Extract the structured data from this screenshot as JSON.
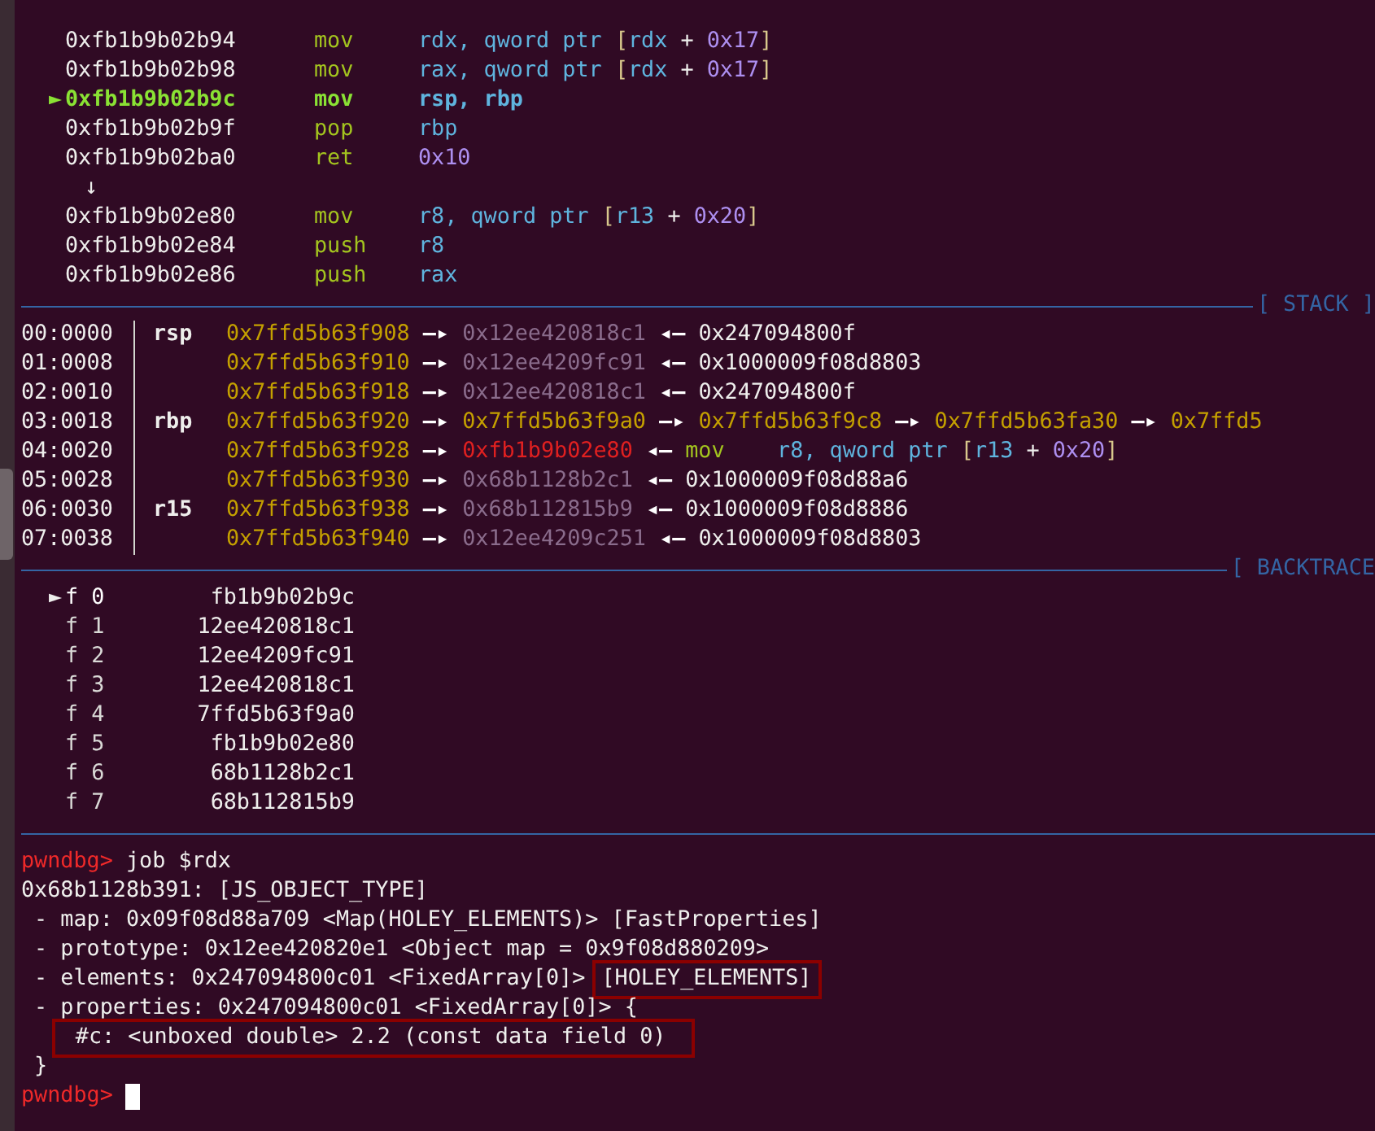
{
  "disassembly": [
    {
      "kind": "instr",
      "current": false,
      "address": "0xfb1b9b02b94",
      "mnemonic": "mov",
      "operands": [
        {
          "text": "rdx, qword ptr ",
          "kind": "reg"
        },
        {
          "text": "[",
          "kind": "brk"
        },
        {
          "text": "rdx ",
          "kind": "reg"
        },
        {
          "text": "+ ",
          "kind": "op"
        },
        {
          "text": "0x17",
          "kind": "num"
        },
        {
          "text": "]",
          "kind": "brk"
        }
      ]
    },
    {
      "kind": "instr",
      "current": false,
      "address": "0xfb1b9b02b98",
      "mnemonic": "mov",
      "operands": [
        {
          "text": "rax, qword ptr ",
          "kind": "reg"
        },
        {
          "text": "[",
          "kind": "brk"
        },
        {
          "text": "rdx ",
          "kind": "reg"
        },
        {
          "text": "+ ",
          "kind": "op"
        },
        {
          "text": "0x17",
          "kind": "num"
        },
        {
          "text": "]",
          "kind": "brk"
        }
      ]
    },
    {
      "kind": "instr",
      "current": true,
      "marker": "►",
      "address": "0xfb1b9b02b9c",
      "mnemonic": "mov",
      "operands": [
        {
          "text": "rsp, rbp",
          "kind": "reg"
        }
      ]
    },
    {
      "kind": "instr",
      "current": false,
      "address": "0xfb1b9b02b9f",
      "mnemonic": "pop",
      "operands": [
        {
          "text": "rbp",
          "kind": "reg"
        }
      ]
    },
    {
      "kind": "instr",
      "current": false,
      "address": "0xfb1b9b02ba0",
      "mnemonic": "ret",
      "operands": [
        {
          "text": "0x10",
          "kind": "num"
        }
      ]
    },
    {
      "kind": "jump",
      "text": "↓"
    },
    {
      "kind": "instr",
      "current": false,
      "address": "0xfb1b9b02e80",
      "mnemonic": "mov",
      "operands": [
        {
          "text": "r8, qword ptr ",
          "kind": "reg"
        },
        {
          "text": "[",
          "kind": "brk"
        },
        {
          "text": "r13 ",
          "kind": "reg"
        },
        {
          "text": "+ ",
          "kind": "op"
        },
        {
          "text": "0x20",
          "kind": "num"
        },
        {
          "text": "]",
          "kind": "brk"
        }
      ]
    },
    {
      "kind": "instr",
      "current": false,
      "address": "0xfb1b9b02e84",
      "mnemonic": "push",
      "operands": [
        {
          "text": "r8",
          "kind": "reg"
        }
      ]
    },
    {
      "kind": "instr",
      "current": false,
      "address": "0xfb1b9b02e86",
      "mnemonic": "push",
      "operands": [
        {
          "text": "rax",
          "kind": "reg"
        }
      ]
    }
  ],
  "stack": {
    "title": "[ STACK ]",
    "rows": [
      {
        "offset": "00:0000",
        "register": "rsp",
        "chain": [
          {
            "text": "0x7ffd5b63f908",
            "kind": "stack"
          },
          {
            "text": "—▸",
            "kind": "arrow"
          },
          {
            "text": "0x12ee420818c1",
            "kind": "heap"
          },
          {
            "text": "◂—",
            "kind": "arrow"
          },
          {
            "text": "0x247094800f",
            "kind": "data"
          }
        ]
      },
      {
        "offset": "01:0008",
        "chain": [
          {
            "text": "0x7ffd5b63f910",
            "kind": "stack"
          },
          {
            "text": "—▸",
            "kind": "arrow"
          },
          {
            "text": "0x12ee4209fc91",
            "kind": "heap"
          },
          {
            "text": "◂—",
            "kind": "arrow"
          },
          {
            "text": "0x1000009f08d8803",
            "kind": "data"
          }
        ]
      },
      {
        "offset": "02:0010",
        "chain": [
          {
            "text": "0x7ffd5b63f918",
            "kind": "stack"
          },
          {
            "text": "—▸",
            "kind": "arrow"
          },
          {
            "text": "0x12ee420818c1",
            "kind": "heap"
          },
          {
            "text": "◂—",
            "kind": "arrow"
          },
          {
            "text": "0x247094800f",
            "kind": "data"
          }
        ]
      },
      {
        "offset": "03:0018",
        "register": "rbp",
        "chain": [
          {
            "text": "0x7ffd5b63f920",
            "kind": "stack"
          },
          {
            "text": "—▸",
            "kind": "arrow"
          },
          {
            "text": "0x7ffd5b63f9a0",
            "kind": "stack"
          },
          {
            "text": "—▸",
            "kind": "arrow"
          },
          {
            "text": "0x7ffd5b63f9c8",
            "kind": "stack"
          },
          {
            "text": "—▸",
            "kind": "arrow"
          },
          {
            "text": "0x7ffd5b63fa30",
            "kind": "stack"
          },
          {
            "text": "—▸",
            "kind": "arrow"
          },
          {
            "text": "0x7ffd5",
            "kind": "stack"
          }
        ]
      },
      {
        "offset": "04:0020",
        "chain": [
          {
            "text": "0x7ffd5b63f928",
            "kind": "stack"
          },
          {
            "text": "—▸",
            "kind": "arrow"
          },
          {
            "text": "0xfb1b9b02e80",
            "kind": "code"
          },
          {
            "text": "◂—",
            "kind": "arrow"
          }
        ],
        "instr": {
          "mnemonic": "mov",
          "operands": [
            {
              "text": "r8, qword ptr ",
              "kind": "reg"
            },
            {
              "text": "[",
              "kind": "brk"
            },
            {
              "text": "r13 ",
              "kind": "reg"
            },
            {
              "text": "+ ",
              "kind": "op"
            },
            {
              "text": "0x20",
              "kind": "num"
            },
            {
              "text": "]",
              "kind": "brk"
            }
          ]
        }
      },
      {
        "offset": "05:0028",
        "chain": [
          {
            "text": "0x7ffd5b63f930",
            "kind": "stack"
          },
          {
            "text": "—▸",
            "kind": "arrow"
          },
          {
            "text": "0x68b1128b2c1",
            "kind": "heap"
          },
          {
            "text": "◂—",
            "kind": "arrow"
          },
          {
            "text": "0x1000009f08d88a6",
            "kind": "data"
          }
        ]
      },
      {
        "offset": "06:0030",
        "register": "r15",
        "chain": [
          {
            "text": "0x7ffd5b63f938",
            "kind": "stack"
          },
          {
            "text": "—▸",
            "kind": "arrow"
          },
          {
            "text": "0x68b112815b9",
            "kind": "heap"
          },
          {
            "text": "◂—",
            "kind": "arrow"
          },
          {
            "text": "0x1000009f08d8886",
            "kind": "data"
          }
        ]
      },
      {
        "offset": "07:0038",
        "chain": [
          {
            "text": "0x7ffd5b63f940",
            "kind": "stack"
          },
          {
            "text": "—▸",
            "kind": "arrow"
          },
          {
            "text": "0x12ee4209c251",
            "kind": "heap"
          },
          {
            "text": "◂—",
            "kind": "arrow"
          },
          {
            "text": "0x1000009f08d8803",
            "kind": "data"
          }
        ]
      }
    ]
  },
  "backtrace": {
    "title": "[ BACKTRACE",
    "marker": "►",
    "frames": [
      {
        "label": "f 0",
        "address": "fb1b9b02b9c",
        "selected": true
      },
      {
        "label": "f 1",
        "address": "12ee420818c1",
        "selected": false
      },
      {
        "label": "f 2",
        "address": "12ee4209fc91",
        "selected": false
      },
      {
        "label": "f 3",
        "address": "12ee420818c1",
        "selected": false
      },
      {
        "label": "f 4",
        "address": "7ffd5b63f9a0",
        "selected": false
      },
      {
        "label": "f 5",
        "address": "fb1b9b02e80",
        "selected": false
      },
      {
        "label": "f 6",
        "address": "68b1128b2c1",
        "selected": false
      },
      {
        "label": "f 7",
        "address": "68b112815b9",
        "selected": false
      }
    ]
  },
  "console": [
    {
      "kind": "command",
      "prompt": "pwndbg>",
      "command": "job $rdx"
    },
    {
      "kind": "output",
      "segments": [
        {
          "text": "0x68b1128b391: [JS_OBJECT_TYPE]",
          "boxed": false
        }
      ]
    },
    {
      "kind": "output",
      "segments": [
        {
          "text": " - map: 0x09f08d88a709 <Map(HOLEY_ELEMENTS)> [FastProperties]",
          "boxed": false
        }
      ]
    },
    {
      "kind": "output",
      "segments": [
        {
          "text": " - prototype: 0x12ee420820e1 <Object map = 0x9f08d880209>",
          "boxed": false
        }
      ]
    },
    {
      "kind": "output",
      "segments": [
        {
          "text": " - elements: 0x247094800c01 <FixedArray[0]> ",
          "boxed": false
        },
        {
          "text": "[HOLEY_ELEMENTS]",
          "boxed": true
        }
      ]
    },
    {
      "kind": "output",
      "segments": [
        {
          "text": " - properties: 0x247094800c01 <FixedArray[0]> {",
          "boxed": false
        }
      ]
    },
    {
      "kind": "output",
      "segments": [
        {
          "text": "#c: <unboxed double> 2.2 (const data field 0)",
          "boxed": true
        }
      ]
    },
    {
      "kind": "output",
      "segments": [
        {
          "text": " }",
          "boxed": false
        }
      ]
    },
    {
      "kind": "command",
      "prompt": "pwndbg>",
      "cursor": true
    }
  ]
}
